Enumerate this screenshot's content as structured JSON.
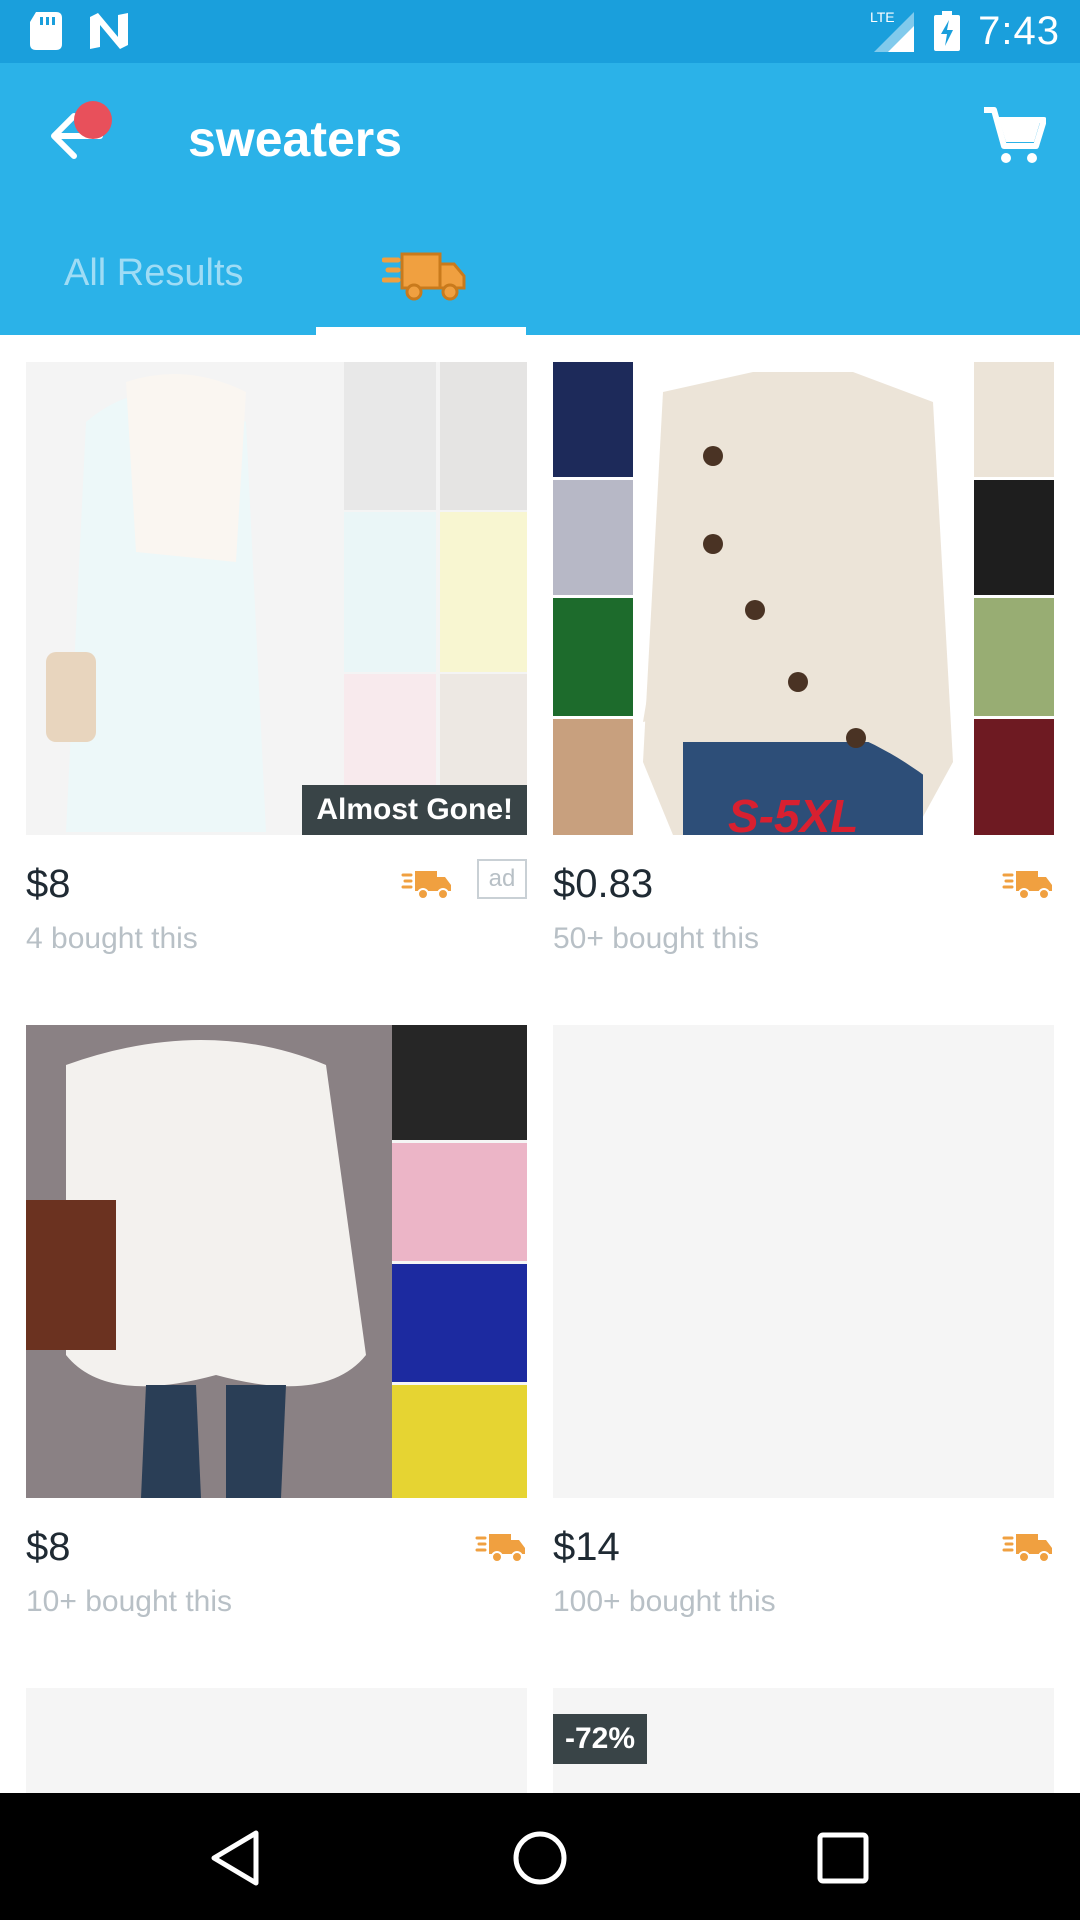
{
  "status_bar": {
    "time": "7:43",
    "network": "LTE",
    "icons": [
      "sd-card-icon",
      "n-logo-icon",
      "signal-icon",
      "battery-charging-icon"
    ]
  },
  "app_bar": {
    "title": "sweaters",
    "back_icon": "arrow-left-icon",
    "cart_icon": "cart-icon"
  },
  "tabs": [
    {
      "label": "All Results",
      "selected": false
    },
    {
      "label": "",
      "icon": "fast-shipping-truck-icon",
      "selected": true
    }
  ],
  "products": [
    {
      "price": "$8",
      "bought": "4 bought this",
      "badge": "Almost Gone!",
      "ad": "ad",
      "fast_shipping": true,
      "image": "fuzzy pastel sweaters collage (faded)"
    },
    {
      "price": "$0.83",
      "bought": "50+ bought this",
      "fast_shipping": true,
      "image": "cream button cardigan collage",
      "image_text": "S-5XL"
    },
    {
      "price": "$8",
      "bought": "10+ bought this",
      "fast_shipping": true,
      "image": "white knit batwing sweater collage"
    },
    {
      "price": "$14",
      "bought": "100+ bought this",
      "fast_shipping": true,
      "image": "placeholder"
    },
    {
      "image": "placeholder"
    },
    {
      "discount": "-72%",
      "image": "placeholder"
    }
  ],
  "colors": {
    "status_bar": "#1a9fdc",
    "app_bar": "#2bb2e8",
    "shipping_orange": "#f0a040",
    "notification_red": "#e8505b"
  }
}
